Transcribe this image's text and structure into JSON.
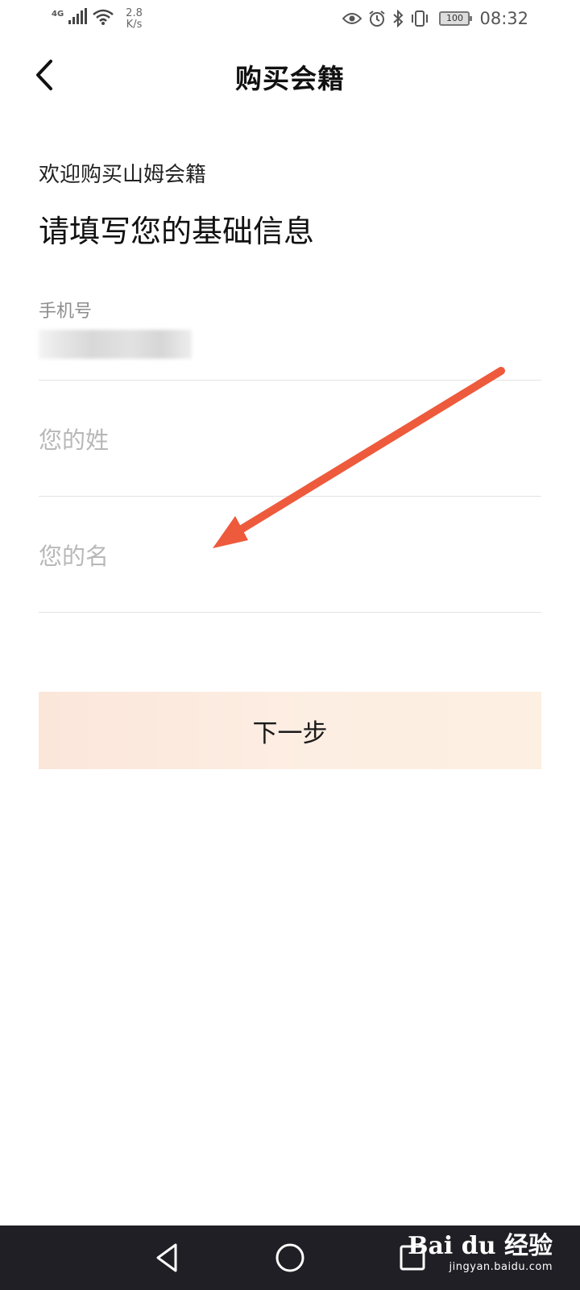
{
  "status_bar": {
    "network_type": "4G",
    "speed_value": "2.8",
    "speed_unit": "K/s",
    "battery": "100",
    "time": "08:32",
    "icons": [
      "eye-icon",
      "alarm-icon",
      "bluetooth-icon",
      "vibrate-icon"
    ]
  },
  "header": {
    "title": "购买会籍",
    "back_icon": "chevron-left-icon"
  },
  "welcome_text": "欢迎购买山姆会籍",
  "section_title": "请填写您的基础信息",
  "form": {
    "phone": {
      "label": "手机号",
      "value_obscured": true
    },
    "last_name": {
      "placeholder": "您的姓",
      "value": ""
    },
    "first_name": {
      "placeholder": "您的名",
      "value": ""
    }
  },
  "next_button": {
    "label": "下一步"
  },
  "annotation": {
    "type": "arrow",
    "color": "#ee5a3c"
  },
  "colors": {
    "accent_button_bg": "#fbe9de",
    "placeholder": "#b8b8b8",
    "nav_bar_bg": "#1f1f25"
  },
  "nav_bar": {
    "buttons": [
      "back-triangle-icon",
      "home-circle-icon",
      "recent-square-icon"
    ]
  },
  "watermark": {
    "brand": "Bai du 经验",
    "url": "jingyan.baidu.com"
  }
}
